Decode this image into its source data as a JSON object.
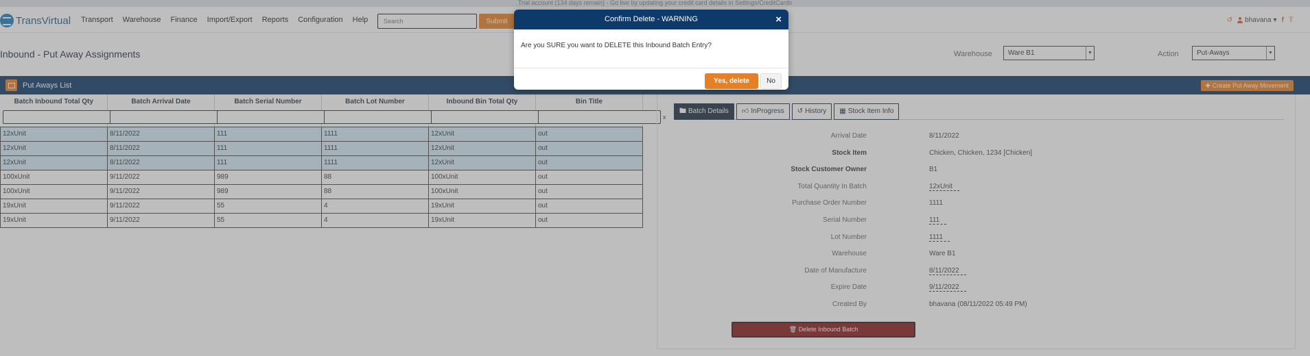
{
  "trial_banner": "Trial account (134 days remain) - Go live by updating your credit card details in Settings/CreditCards",
  "navbar": {
    "logo_text": "TransVirtual",
    "menu": [
      "Transport",
      "Warehouse",
      "Finance",
      "Import/Export",
      "Reports",
      "Configuration",
      "Help"
    ],
    "search_placeholder": "Search",
    "submit_label": "Submit",
    "user_name": "bhavana"
  },
  "page": {
    "title": "Inbound - Put Away Assignments",
    "warehouse_label": "Warehouse",
    "warehouse_value": "Ware B1",
    "action_label": "Action",
    "action_value": "Put-Aways"
  },
  "list_panel": {
    "title": "Put Aways List",
    "create_button": "Create Put Away Movement"
  },
  "table": {
    "columns": [
      "Batch Inbound Total Qty",
      "Batch Arrival Date",
      "Batch Serial Number",
      "Batch Lot Number",
      "Inbound Bin Total Qty",
      "Bin Title"
    ],
    "filter_clear": "x",
    "rows": [
      [
        "12xUnit",
        "8/11/2022",
        "111",
        "1111",
        "12xUnit",
        "out"
      ],
      [
        "12xUnit",
        "8/11/2022",
        "111",
        "1111",
        "12xUnit",
        "out"
      ],
      [
        "12xUnit",
        "8/11/2022",
        "111",
        "1111",
        "12xUnit",
        "out"
      ],
      [
        "100xUnit",
        "9/11/2022",
        "989",
        "88",
        "100xUnit",
        "out"
      ],
      [
        "100xUnit",
        "9/11/2022",
        "989",
        "88",
        "100xUnit",
        "out"
      ],
      [
        "19xUnit",
        "9/11/2022",
        "55",
        "4",
        "19xUnit",
        "out"
      ],
      [
        "19xUnit",
        "9/11/2022",
        "55",
        "4",
        "19xUnit",
        "out"
      ]
    ]
  },
  "details": {
    "tabs": [
      "Batch Details",
      "InProgress",
      "History",
      "Stock Item Info"
    ],
    "fields": [
      {
        "label": "Arrival Date",
        "value": "8/11/2022"
      },
      {
        "label": "Stock Item",
        "value": "Chicken, Chicken, 1234 [Chicken]"
      },
      {
        "label": "Stock Customer Owner",
        "value": "B1"
      },
      {
        "label": "Total Quantity In Batch",
        "value": "12xUnit"
      },
      {
        "label": "Purchase Order Number",
        "value": "1111"
      },
      {
        "label": "Serial Number",
        "value": "111"
      },
      {
        "label": "Lot Number",
        "value": "1111"
      },
      {
        "label": "Warehouse",
        "value": "Ware B1"
      },
      {
        "label": "Date of Manufacture",
        "value": "8/11/2022"
      },
      {
        "label": "Expire Date",
        "value": "9/11/2022"
      },
      {
        "label": "Created By",
        "value": "bhavana (08/11/2022 05:49 PM)"
      }
    ],
    "delete_button": "Delete Inbound Batch"
  },
  "modal": {
    "title": "Confirm Delete - WARNING",
    "close_symbol": "×",
    "message": "Are you SURE you want to DELETE this Inbound Batch Entry?",
    "yes_label": "Yes, delete",
    "no_label": "No"
  },
  "colors": {
    "navy": "#0d3a6a",
    "orange": "#e58025",
    "danger": "#8b1b1b",
    "selected_row": "#d6eaf8"
  }
}
